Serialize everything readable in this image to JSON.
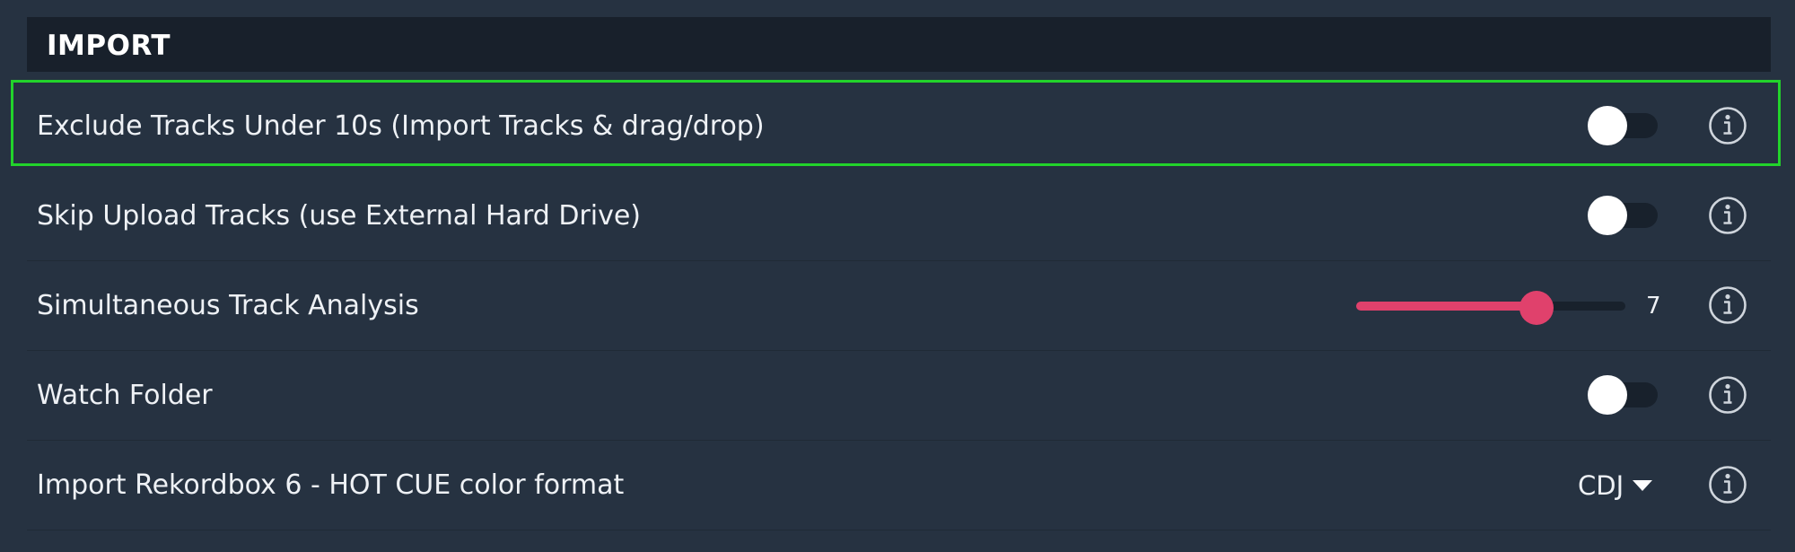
{
  "section": {
    "title": "IMPORT"
  },
  "rows": [
    {
      "label": "Exclude Tracks Under 10s (Import Tracks & drag/drop)",
      "control": "toggle",
      "enabled": false
    },
    {
      "label": "Skip Upload Tracks (use External Hard Drive)",
      "control": "toggle",
      "enabled": false
    },
    {
      "label": "Simultaneous Track Analysis",
      "control": "slider",
      "value": "7",
      "slider_fraction": 0.67
    },
    {
      "label": "Watch Folder",
      "control": "toggle",
      "enabled": false
    },
    {
      "label": "Import Rekordbox 6 - HOT CUE color format",
      "control": "dropdown",
      "selected": "CDJ"
    }
  ],
  "icons": {
    "info": "info-icon",
    "dropdown_arrow": "chevron-down-icon"
  },
  "colors": {
    "background": "#263241",
    "header_background": "#18202b",
    "accent": "#e0416c",
    "highlight_border": "#22d32b",
    "toggle_track": "#18212c"
  }
}
